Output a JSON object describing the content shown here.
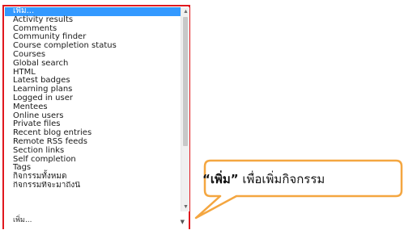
{
  "listbox": {
    "options": [
      "เพิ่ม...",
      "Activity results",
      "Comments",
      "Community finder",
      "Course completion status",
      "Courses",
      "Global search",
      "HTML",
      "Latest badges",
      "Learning plans",
      "Logged in user",
      "Mentees",
      "Online users",
      "Private files",
      "Recent blog entries",
      "Remote RSS feeds",
      "Section links",
      "Self completion",
      "Tags",
      "กิจกรรมทั้งหมด",
      "กิจกรรมที่จะมาถึงนี้"
    ],
    "selected_index": 0,
    "scroll_up_icon": "▲",
    "scroll_down_icon": "▼"
  },
  "closed_select": {
    "value": "เพิ่ม...",
    "arrow_icon": "▼"
  },
  "callout": {
    "keyword": "“เพิ่ม”",
    "text": " เพื่อเพิ่มกิจกรรม",
    "border_color": "#f4a640"
  },
  "colors": {
    "frame_border": "#e0181e",
    "selected_bg": "#3399ff"
  }
}
